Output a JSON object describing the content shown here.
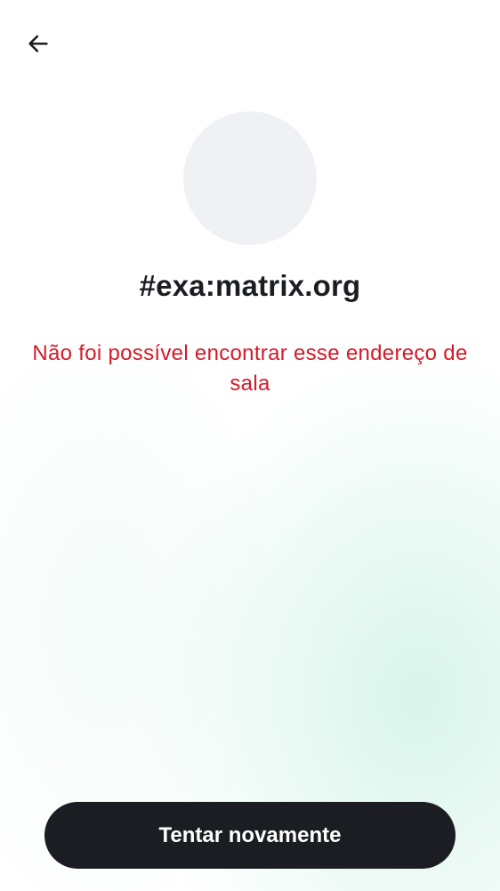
{
  "header": {
    "back_icon": "arrow-left-icon"
  },
  "room": {
    "avatar_color": "#f0f1f5",
    "address": "#exa:matrix.org",
    "error_message": "Não foi possível encontrar esse endereço de sala",
    "error_color": "#d51928"
  },
  "actions": {
    "retry_label": "Tentar novamente",
    "retry_color": "#1b1d22"
  }
}
